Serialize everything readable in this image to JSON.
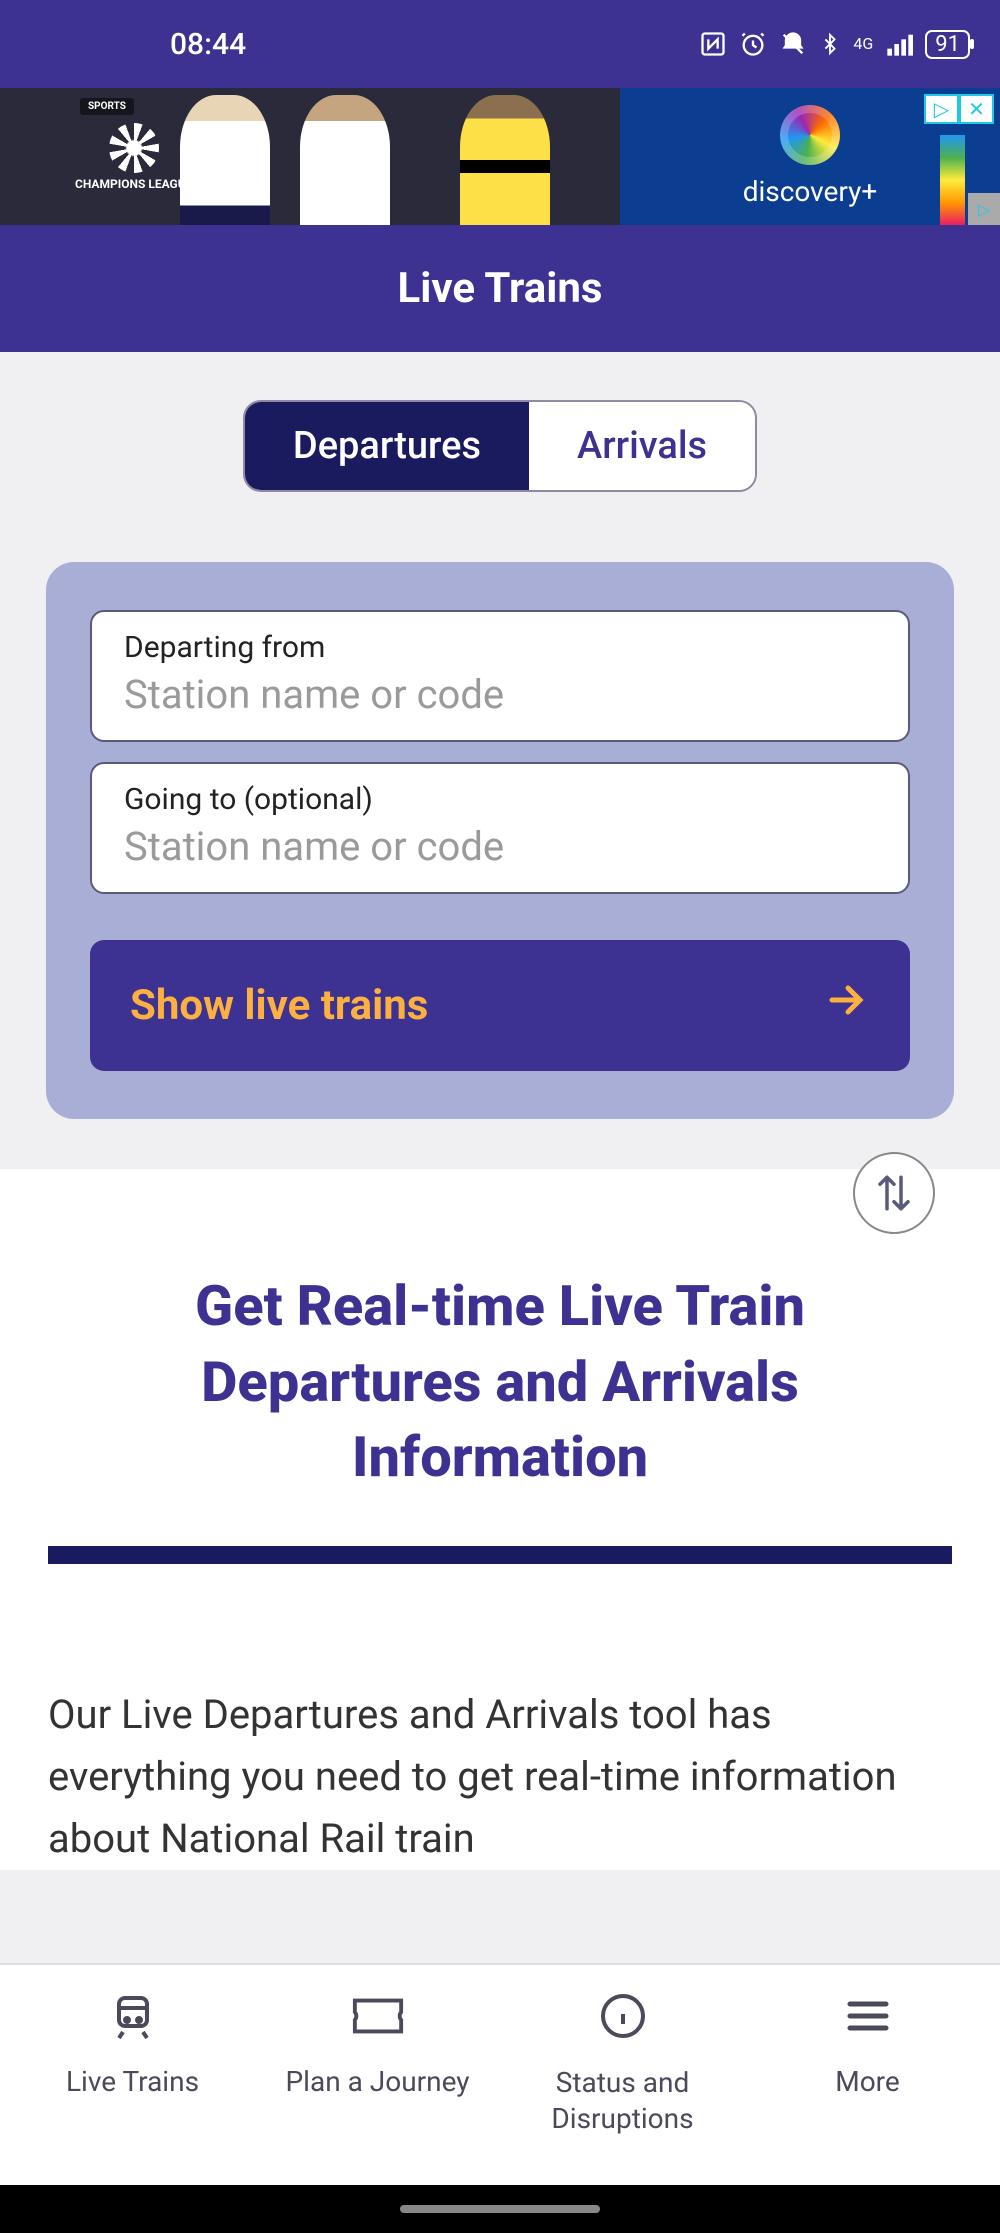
{
  "status": {
    "time": "08:44",
    "battery": "91",
    "network": "4G"
  },
  "ad": {
    "sports_badge": "SPORTS",
    "competition": "CHAMPIONS LEAGUE",
    "brand": "discovery+"
  },
  "header": {
    "title": "Live Trains"
  },
  "tabs": {
    "departures": "Departures",
    "arrivals": "Arrivals",
    "active": "departures"
  },
  "search": {
    "from_label": "Departing from",
    "from_placeholder": "Station name or code",
    "to_label": "Going to (optional)",
    "to_placeholder": "Station name or code",
    "submit": "Show live trains"
  },
  "content": {
    "heading": "Get Real-time Live Train Departures and Arrivals Information",
    "body": "Our Live Departures and Arrivals tool has everything you need to get real-time information about National Rail train"
  },
  "nav": {
    "items": [
      {
        "label": "Live Trains",
        "icon": "train-icon"
      },
      {
        "label": "Plan a Journey",
        "icon": "ticket-icon"
      },
      {
        "label": "Status and Disruptions",
        "icon": "info-icon"
      },
      {
        "label": "More",
        "icon": "menu-icon"
      }
    ]
  }
}
